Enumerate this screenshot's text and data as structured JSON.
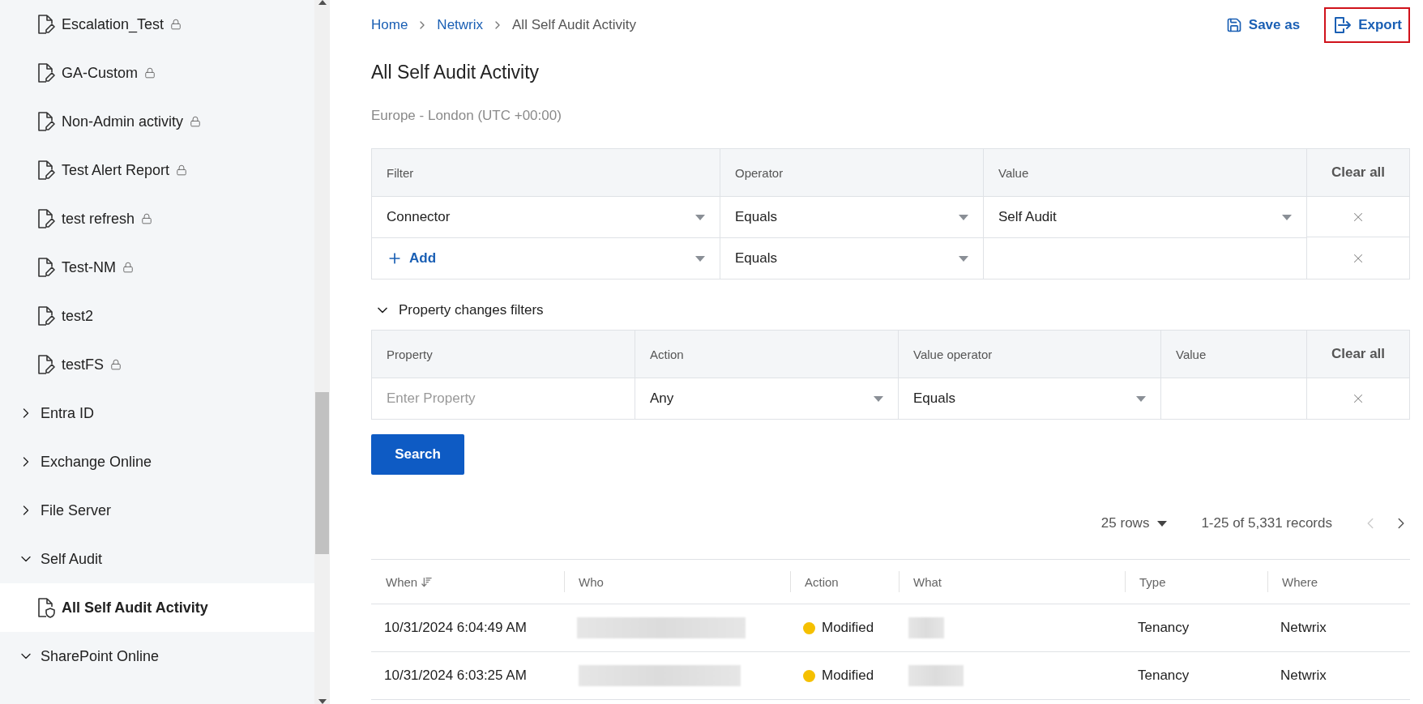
{
  "sidebar": {
    "items": [
      {
        "kind": "report",
        "label": "Escalation_Test",
        "locked": true,
        "selected": false
      },
      {
        "kind": "report",
        "label": "GA-Custom",
        "locked": true,
        "selected": false
      },
      {
        "kind": "report",
        "label": "Non-Admin activity",
        "locked": true,
        "selected": false
      },
      {
        "kind": "report",
        "label": "Test Alert Report",
        "locked": true,
        "selected": false
      },
      {
        "kind": "report",
        "label": "test refresh",
        "locked": true,
        "selected": false
      },
      {
        "kind": "report",
        "label": "Test-NM",
        "locked": true,
        "selected": false
      },
      {
        "kind": "report",
        "label": "test2",
        "locked": false,
        "selected": false
      },
      {
        "kind": "report",
        "label": "testFS",
        "locked": true,
        "selected": false
      },
      {
        "kind": "folder",
        "label": "Entra ID",
        "expanded": false
      },
      {
        "kind": "folder",
        "label": "Exchange Online",
        "expanded": false
      },
      {
        "kind": "folder",
        "label": "File Server",
        "expanded": false
      },
      {
        "kind": "folder",
        "label": "Self Audit",
        "expanded": true,
        "children": [
          {
            "kind": "audit",
            "label": "All Self Audit Activity",
            "locked": false,
            "selected": true
          }
        ]
      },
      {
        "kind": "folder",
        "label": "SharePoint Online",
        "expanded": true
      }
    ]
  },
  "breadcrumb": [
    {
      "label": "Home",
      "link": true
    },
    {
      "label": "Netwrix",
      "link": true
    },
    {
      "label": "All Self Audit Activity",
      "link": false
    }
  ],
  "actions": [
    {
      "kind": "save",
      "label": "Save as",
      "highlighted": false
    },
    {
      "kind": "export",
      "label": "Export",
      "highlighted": true
    }
  ],
  "title": "All Self Audit Activity",
  "timezone": "Europe - London (UTC +00:00)",
  "filters": {
    "columns": [
      "Filter",
      "Operator",
      "Value"
    ],
    "clear_all": "Clear all",
    "rows": [
      {
        "filter": {
          "kind": "select",
          "value": "Connector"
        },
        "operator": "Equals",
        "value": "Self Audit"
      },
      {
        "filter": {
          "kind": "add",
          "value": "Add"
        },
        "operator": "Equals",
        "value": ""
      }
    ]
  },
  "property_filters": {
    "label": "Property changes filters",
    "expanded": true,
    "columns": [
      "Property",
      "Action",
      "Value operator",
      "Value"
    ],
    "clear_all": "Clear all",
    "rows": [
      {
        "property_placeholder": "Enter Property",
        "action": "Any",
        "value_operator": "Equals",
        "value": ""
      }
    ]
  },
  "search_button": "Search",
  "pagination": {
    "rows_per_page": "25 rows",
    "range": "1-25 of 5,331 records",
    "prev_disabled": true,
    "next_disabled": false
  },
  "results": {
    "columns": [
      {
        "label": "When",
        "sorted": true
      },
      {
        "label": "Who",
        "sorted": false
      },
      {
        "label": "Action",
        "sorted": false
      },
      {
        "label": "What",
        "sorted": false
      },
      {
        "label": "Type",
        "sorted": false
      },
      {
        "label": "Where",
        "sorted": false
      }
    ],
    "rows": [
      {
        "when": "10/31/2024 6:04:49 AM",
        "action": {
          "label": "Modified",
          "color": "#f5c000"
        },
        "type": "Tenancy",
        "where": "Netwrix"
      },
      {
        "when": "10/31/2024 6:03:25 AM",
        "action": {
          "label": "Modified",
          "color": "#f5c000"
        },
        "type": "Tenancy",
        "where": "Netwrix"
      }
    ]
  }
}
